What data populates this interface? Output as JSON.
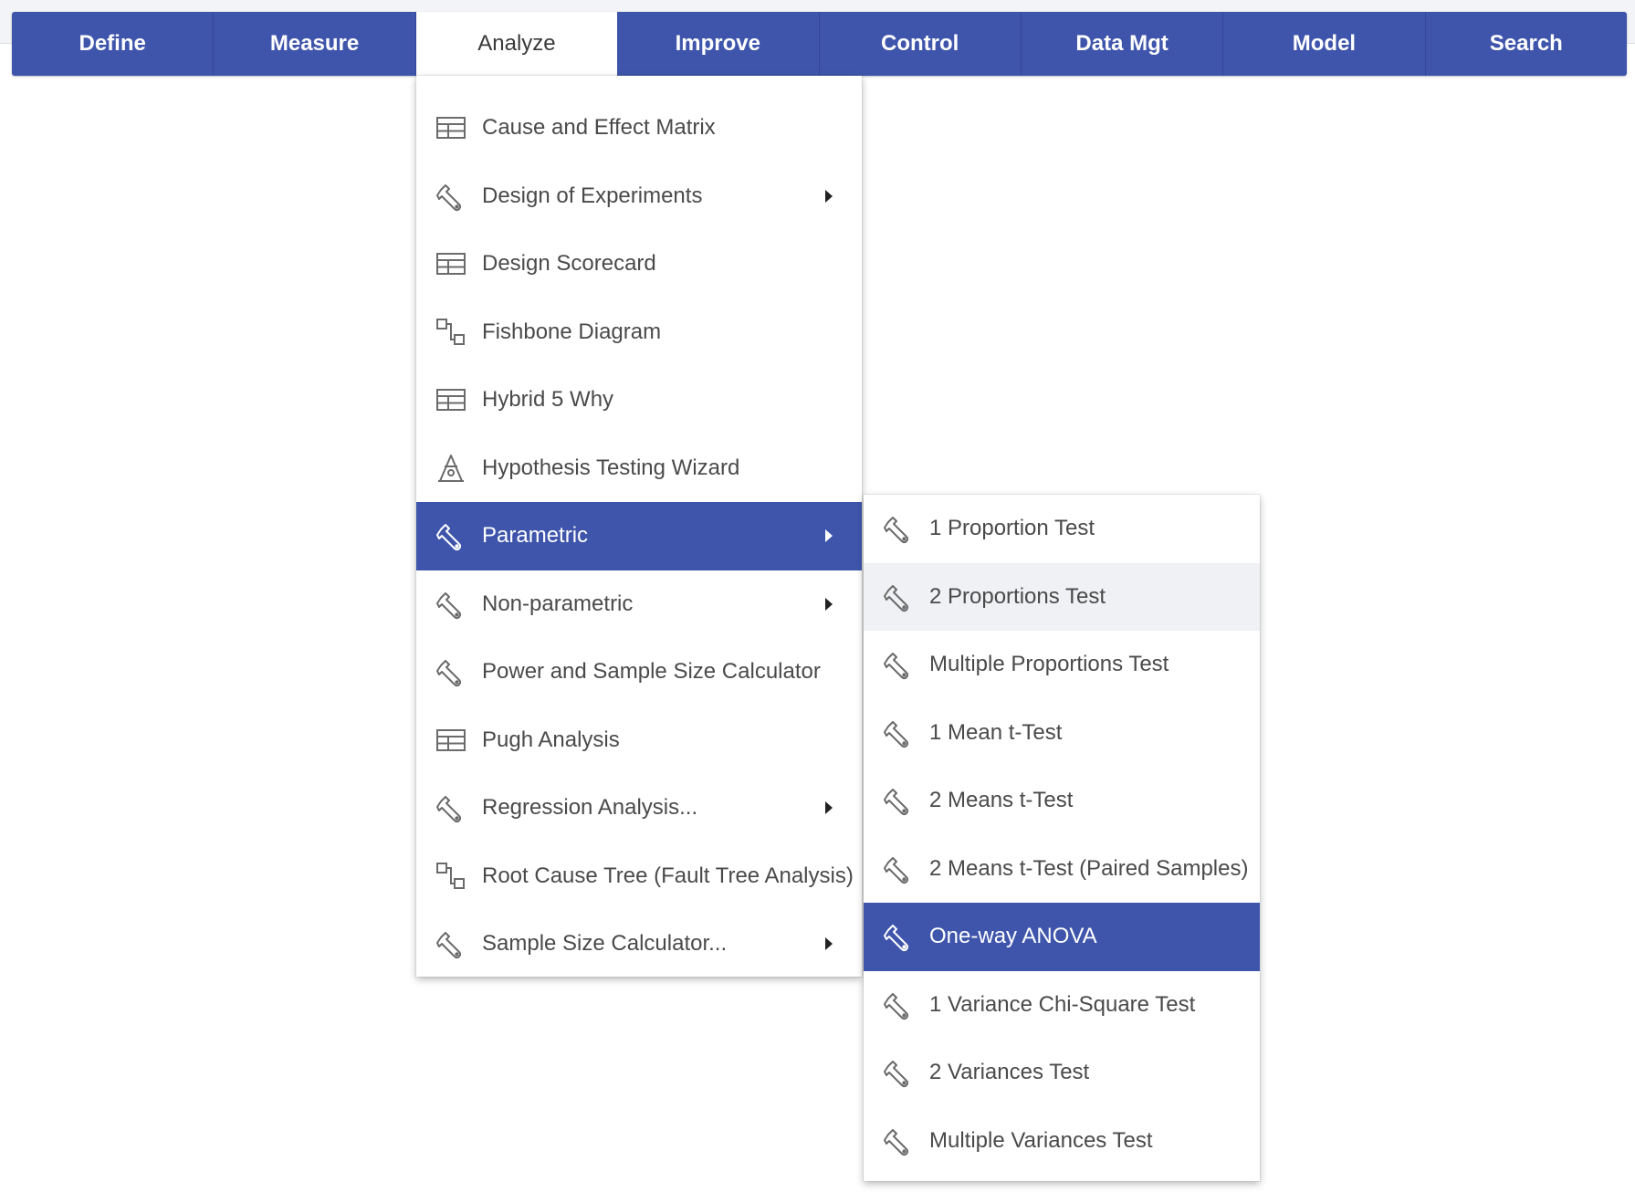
{
  "nav": {
    "tabs": [
      {
        "label": "Define",
        "active": false
      },
      {
        "label": "Measure",
        "active": false
      },
      {
        "label": "Analyze",
        "active": true
      },
      {
        "label": "Improve",
        "active": false
      },
      {
        "label": "Control",
        "active": false
      },
      {
        "label": "Data Mgt",
        "active": false
      },
      {
        "label": "Model",
        "active": false
      },
      {
        "label": "Search",
        "active": false
      }
    ]
  },
  "analyze_menu": {
    "items": [
      {
        "label": "Cause and Effect Matrix",
        "icon": "table-icon",
        "submenu": false
      },
      {
        "label": "Design of Experiments",
        "icon": "wrench-icon",
        "submenu": true
      },
      {
        "label": "Design Scorecard",
        "icon": "table-icon",
        "submenu": false
      },
      {
        "label": "Fishbone Diagram",
        "icon": "diagram-icon",
        "submenu": false
      },
      {
        "label": "Hybrid 5 Why",
        "icon": "table-icon",
        "submenu": false
      },
      {
        "label": "Hypothesis Testing Wizard",
        "icon": "wizard-icon",
        "submenu": false
      },
      {
        "label": "Parametric",
        "icon": "wrench-icon",
        "submenu": true,
        "state": "highlighted"
      },
      {
        "label": "Non-parametric",
        "icon": "wrench-icon",
        "submenu": true
      },
      {
        "label": "Power and Sample Size Calculator",
        "icon": "wrench-icon",
        "submenu": false
      },
      {
        "label": "Pugh Analysis",
        "icon": "table-icon",
        "submenu": false
      },
      {
        "label": "Regression Analysis...",
        "icon": "wrench-icon",
        "submenu": true
      },
      {
        "label": "Root Cause Tree (Fault Tree Analysis)",
        "icon": "diagram-icon",
        "submenu": false
      },
      {
        "label": "Sample Size Calculator...",
        "icon": "wrench-icon",
        "submenu": true
      }
    ]
  },
  "parametric_menu": {
    "items": [
      {
        "label": "1 Proportion Test",
        "icon": "wrench-icon"
      },
      {
        "label": "2 Proportions Test",
        "icon": "wrench-icon",
        "state": "hover"
      },
      {
        "label": "Multiple Proportions Test",
        "icon": "wrench-icon"
      },
      {
        "label": "1 Mean t-Test",
        "icon": "wrench-icon"
      },
      {
        "label": "2 Means t-Test",
        "icon": "wrench-icon"
      },
      {
        "label": "2 Means t-Test (Paired Samples)",
        "icon": "wrench-icon"
      },
      {
        "label": "One-way ANOVA",
        "icon": "wrench-icon",
        "state": "highlighted"
      },
      {
        "label": "1 Variance Chi-Square Test",
        "icon": "wrench-icon"
      },
      {
        "label": "2 Variances Test",
        "icon": "wrench-icon"
      },
      {
        "label": "Multiple Variances Test",
        "icon": "wrench-icon"
      }
    ]
  },
  "colors": {
    "nav_bg": "#3e55ab",
    "highlight": "#3e55ab",
    "hover": "#f0f1f4",
    "text": "#4a4a4a",
    "icon": "#6b6b6b"
  }
}
